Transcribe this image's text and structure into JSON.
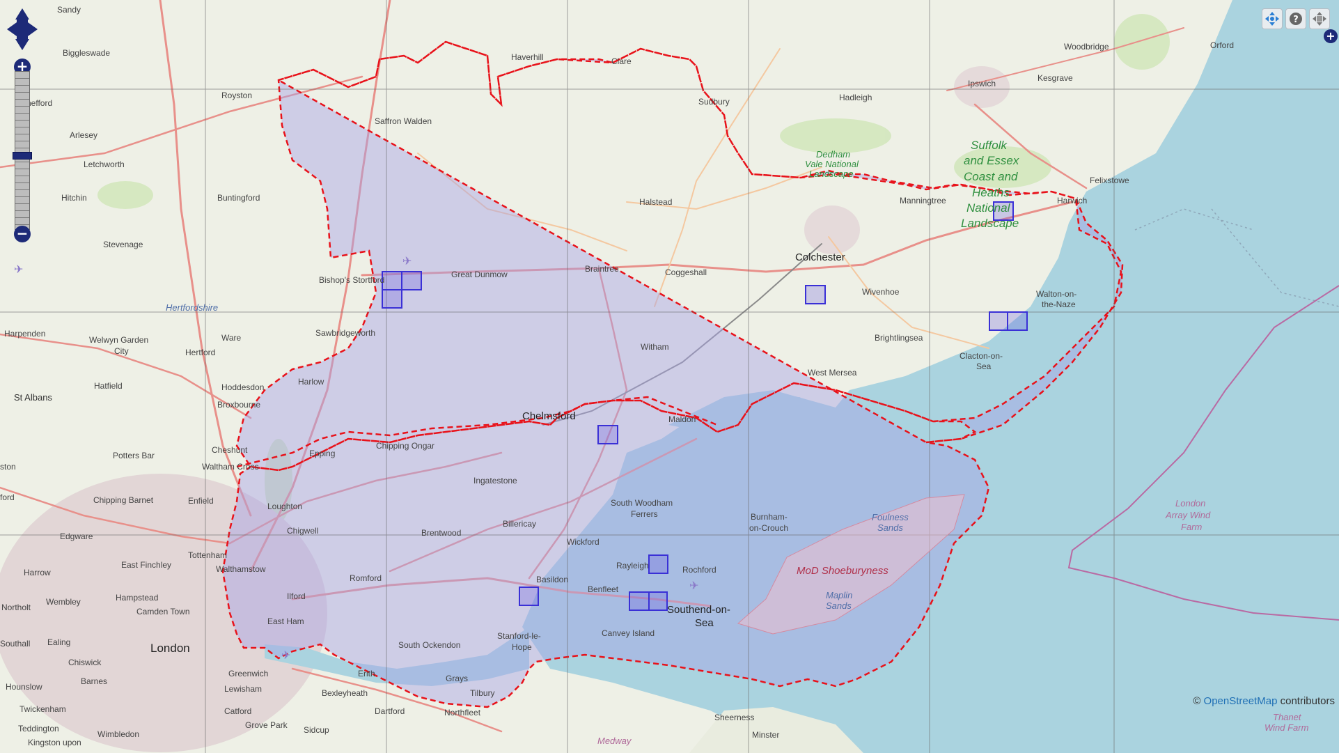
{
  "map": {
    "attribution_prefix": "©",
    "attribution_link": "OpenStreetMap",
    "attribution_suffix": "contributors",
    "zoom_in_label": "+",
    "zoom_out_label": "−",
    "layer_switcher_label": "+",
    "colors": {
      "land": "#eef0e6",
      "sea": "#aad3df",
      "selection_fill": "#a7a2e6",
      "boundary": "#e8121a",
      "sample_box": "#3a30d6",
      "grid": "#666666",
      "road_major": "#e8908a",
      "road_minor": "#f4c8a0"
    },
    "labels": {
      "sandy": "Sandy",
      "biggleswade": "Biggleswade",
      "royston": "Royston",
      "shefford": "Shefford",
      "arlesey": "Arlesey",
      "letchworth": "Letchworth",
      "hitchin": "Hitchin",
      "buntingford": "Buntingford",
      "stevenage": "Stevenage",
      "hertfordshire": "Hertfordshire",
      "harpenden": "Harpenden",
      "welwyn1": "Welwyn Garden",
      "welwyn2": "City",
      "hertford": "Hertford",
      "ware": "Ware",
      "st_albans": "St Albans",
      "hatfield": "Hatfield",
      "hoddesdon": "Hoddesdon",
      "broxbourne": "Broxbourne",
      "potters_bar": "Potters Bar",
      "cheshunt": "Cheshunt",
      "waltham_cross": "Waltham Cross",
      "chipping_barnet": "Chipping Barnet",
      "enfield": "Enfield",
      "edgware": "Edgware",
      "east_finchley": "East Finchley",
      "harrow": "Harrow",
      "tottenham": "Tottenham",
      "walthamstow": "Walthamstow",
      "hampstead": "Hampstead",
      "camden": "Camden Town",
      "wembley": "Wembley",
      "northolt": "Northolt",
      "southall": "Southall",
      "ealing": "Ealing",
      "london": "London",
      "chiswick": "Chiswick",
      "barnes": "Barnes",
      "hounslow": "Hounslow",
      "twickenham": "Twickenham",
      "teddington": "Teddington",
      "kingston": "Kingston upon",
      "wimbledon": "Wimbledon",
      "ston": "ston",
      "ford": "ford",
      "haverhill": "Haverhill",
      "clare": "Clare",
      "sudbury": "Sudbury",
      "hadleigh": "Hadleigh",
      "ipswich": "Ipswich",
      "kesgrave": "Kesgrave",
      "woodbridge": "Woodbridge",
      "orford": "Orford",
      "dedham1": "Dedham",
      "dedham2": "Vale National",
      "dedham3": "Landscape",
      "suffolk1": "Suffolk",
      "suffolk2": "and Essex",
      "suffolk3": "Coast and",
      "suffolk4": "Heaths",
      "suffolk5": "National",
      "suffolk6": "Landscape",
      "felixstowe": "Felixstowe",
      "harwich": "Harwich",
      "manningtree": "Manningtree",
      "saffron_walden": "Saffron Walden",
      "halstead": "Halstead",
      "colchester": "Colchester",
      "bishops_stortford": "Bishop's Stortford",
      "great_dunmow": "Great Dunmow",
      "braintree": "Braintree",
      "coggeshall": "Coggeshall",
      "wivenhoe": "Wivenhoe",
      "walton1": "Walton-on-",
      "walton2": "the-Naze",
      "sawbridgeworth": "Sawbridgeworth",
      "witham": "Witham",
      "brightlingsea": "Brightlingsea",
      "clacton1": "Clacton-on-",
      "clacton2": "Sea",
      "harlow": "Harlow",
      "west_mersea": "West Mersea",
      "chelmsford": "Chelmsford",
      "maldon": "Maldon",
      "epping": "Epping",
      "chipping_ongar": "Chipping Ongar",
      "ingatestone": "Ingatestone",
      "loughton": "Loughton",
      "south_woodham1": "South Woodham",
      "south_woodham2": "Ferrers",
      "billericay": "Billericay",
      "burnham1": "Burnham-",
      "burnham2": "on-Crouch",
      "chigwell": "Chigwell",
      "brentwood": "Brentwood",
      "wickford": "Wickford",
      "foulness1": "Foulness",
      "foulness2": "Sands",
      "rayleigh": "Rayleigh",
      "rochford": "Rochford",
      "mod": "MoD Shoeburyness",
      "romford": "Romford",
      "basildon": "Basildon",
      "ilford": "Ilford",
      "benfleet": "Benfleet",
      "southend1": "Southend-on-",
      "southend2": "Sea",
      "maplin1": "Maplin",
      "maplin2": "Sands",
      "east_ham": "East Ham",
      "canvey": "Canvey Island",
      "south_ockendon": "South Ockendon",
      "stanford1": "Stanford-le-",
      "stanford2": "Hope",
      "grays": "Grays",
      "tilbury": "Tilbury",
      "greenwich": "Greenwich",
      "lewisham": "Lewisham",
      "erith": "Erith",
      "bexleyheath": "Bexleyheath",
      "catford": "Catford",
      "dartford": "Dartford",
      "northfleet": "Northfleet",
      "grove_park": "Grove Park",
      "sidcup": "Sidcup",
      "sheerness": "Sheerness",
      "minster": "Minster",
      "medway": "Medway",
      "london_array1": "London",
      "london_array2": "Array Wind",
      "london_array3": "Farm",
      "thanet1": "Thanet",
      "thanet2": "Wind Farm"
    }
  }
}
